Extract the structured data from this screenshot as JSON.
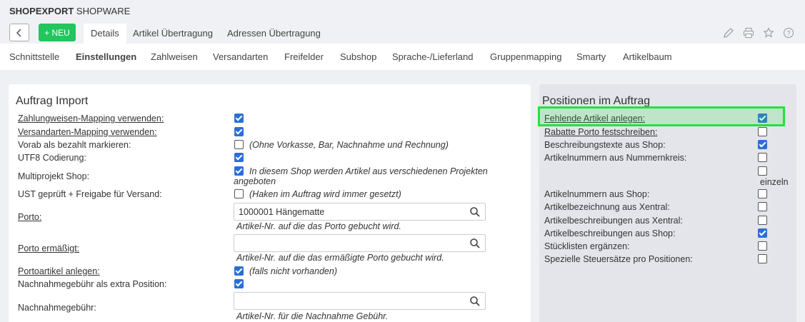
{
  "header": {
    "brand_bold": "SHOPEXPORT",
    "brand_light": "SHOPWARE",
    "new_label": "+ NEU",
    "tabs": [
      "Details",
      "Artikel Übertragung",
      "Adressen Übertragung"
    ]
  },
  "subnav": [
    "Schnittstelle",
    "Einstellungen",
    "Zahlweisen",
    "Versandarten",
    "Freifelder",
    "Subshop",
    "Sprache-/Lieferland",
    "Gruppenmapping",
    "Smarty",
    "Artikelbaum"
  ],
  "left": {
    "title": "Auftrag Import",
    "rows": [
      {
        "label": "Zahlungweisen-Mapping verwenden:",
        "checked": true,
        "hint": ""
      },
      {
        "label": "Versandarten-Mapping verwenden:",
        "checked": true,
        "hint": ""
      },
      {
        "label": "Vorab als bezahlt markieren:",
        "checked": false,
        "hint": "(Ohne Vorkasse, Bar, Nachnahme und Rechnung)"
      },
      {
        "label": "UTF8 Codierung:",
        "checked": true,
        "hint": ""
      },
      {
        "label": "Multiprojekt Shop:",
        "checked": true,
        "hint": "In diesem Shop werden Artikel aus verschiedenen Projekten",
        "hint2": "angeboten"
      },
      {
        "label": "UST geprüft + Freigabe für Versand:",
        "checked": false,
        "hint": "(Haken im Auftrag wird immer gesetzt)"
      }
    ],
    "porto": {
      "label": "Porto:",
      "value": "1000001 Hängematte",
      "hint": "Artikel-Nr. auf die das Porto gebucht wird."
    },
    "porto_reduced": {
      "label": "Porto ermäßigt:",
      "value": "",
      "hint": "Artikel-Nr. auf die das ermäßigte Porto gebucht wird."
    },
    "portoartikel": {
      "label": "Portoartikel anlegen:",
      "checked": true,
      "hint": "(falls nicht vorhanden)"
    },
    "nachnahme_pos": {
      "label": "Nachnahmegebühr als extra Position:",
      "checked": true
    },
    "nachnahme": {
      "label": "Nachnahmegebühr:",
      "value": "",
      "hint": "Artikel-Nr. für die Nachnahme Gebühr."
    }
  },
  "right": {
    "title": "Positionen im Auftrag",
    "rows": [
      {
        "label": "Fehlende Artikel anlegen:",
        "checked": true
      },
      {
        "label": "Rabatte Porto festschreiben:",
        "checked": false
      },
      {
        "label": "Beschreibungstexte aus Shop:",
        "checked": true
      },
      {
        "label": "Artikelnummern aus Nummernkreis:",
        "checked": false
      }
    ],
    "einzeln": "einzeln",
    "rows2": [
      {
        "label": "Artikelnummern aus Shop:",
        "checked": false
      },
      {
        "label": "Artikelbezeichnung aus Xentral:",
        "checked": false
      },
      {
        "label": "Artikelbeschreibungen aus Xentral:",
        "checked": false
      },
      {
        "label": "Artikelbeschreibungen aus Shop:",
        "checked": true
      },
      {
        "label": "Stücklisten ergänzen:",
        "checked": false
      },
      {
        "label": "Spezielle Steuersätze pro Positionen:",
        "checked": false
      }
    ]
  }
}
